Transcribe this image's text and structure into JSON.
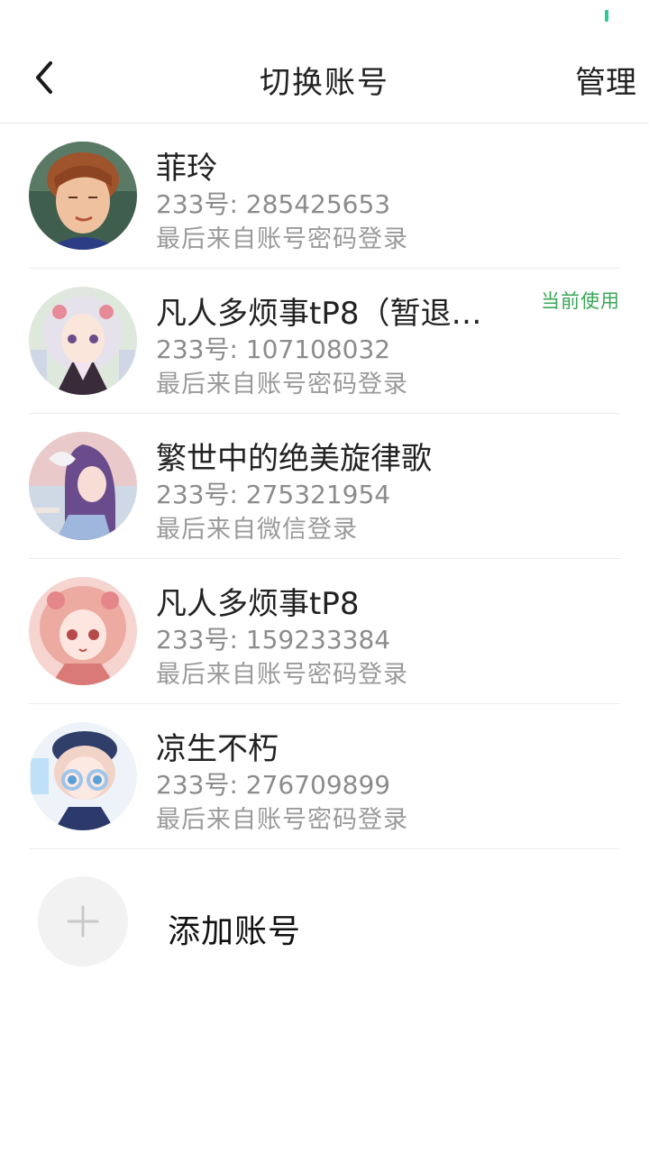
{
  "colors": {
    "accent": "#3aa757",
    "status_indicator": "#2ec99b",
    "divider": "#ececec"
  },
  "header": {
    "back_icon": "chevron-left-icon",
    "title": "切换账号",
    "manage_label": "管理"
  },
  "accounts": [
    {
      "name": "菲玲",
      "id_text": "233号: 285425653",
      "login_text": "最后来自账号密码登录",
      "current_label": ""
    },
    {
      "name": "凡人多烦事tP8（暂退…",
      "id_text": "233号: 107108032",
      "login_text": "最后来自账号密码登录",
      "current_label": "当前使用"
    },
    {
      "name": "繁世中的绝美旋律歌",
      "id_text": "233号: 275321954",
      "login_text": "最后来自微信登录",
      "current_label": ""
    },
    {
      "name": "凡人多烦事tP8",
      "id_text": "233号: 159233384",
      "login_text": "最后来自账号密码登录",
      "current_label": ""
    },
    {
      "name": "凉生不朽",
      "id_text": "233号: 276709899",
      "login_text": "最后来自账号密码登录",
      "current_label": ""
    }
  ],
  "add_account": {
    "icon": "plus-icon",
    "label": "添加账号"
  }
}
